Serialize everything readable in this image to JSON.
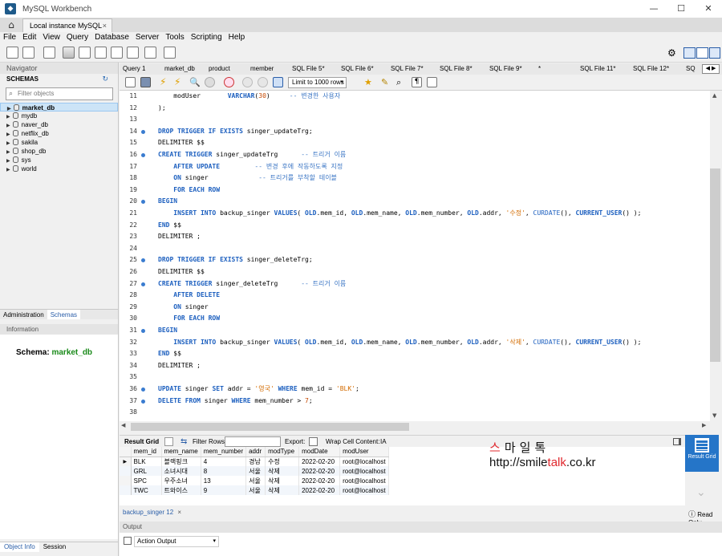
{
  "window": {
    "title": "MySQL Workbench",
    "tab_label": "Local instance MySQL"
  },
  "menu": [
    "File",
    "Edit",
    "View",
    "Query",
    "Database",
    "Server",
    "Tools",
    "Scripting",
    "Help"
  ],
  "navigator": {
    "header": "Navigator",
    "schemas_label": "SCHEMAS",
    "filter_placeholder": "Filter objects",
    "schemas": [
      "market_db",
      "mydb",
      "naver_db",
      "netflix_db",
      "sakila",
      "shop_db",
      "sys",
      "world"
    ],
    "selected": "market_db",
    "tabs": [
      "Administration",
      "Schemas"
    ],
    "info_header": "Information",
    "info_label": "Schema:",
    "info_value": "market_db",
    "bottom_tabs": [
      "Object Info",
      "Session"
    ]
  },
  "query_tabs": [
    "Query 1",
    "market_db",
    "product",
    "member",
    "SQL File 5*",
    "SQL File 6*",
    "SQL File 7*",
    "SQL File 8*",
    "SQL File 9*",
    "*",
    "SQL File 11*",
    "SQL File 12*",
    "SQ"
  ],
  "editor_toolbar": {
    "limit": "Limit to 1000 rows"
  },
  "code_lines": [
    {
      "n": "11",
      "dot": false,
      "html": "    modUser       <span class=\"kw\">VARCHAR</span>(<span class=\"nm\">30</span>)     <span class=\"cm\">-- 변경한 사용자</span>"
    },
    {
      "n": "12",
      "dot": false,
      "html": ");"
    },
    {
      "n": "13",
      "dot": false,
      "html": ""
    },
    {
      "n": "14",
      "dot": true,
      "html": "<span class=\"kw\">DROP TRIGGER IF EXISTS</span> singer_updateTrg;"
    },
    {
      "n": "15",
      "dot": false,
      "html": "DELIMITER $$"
    },
    {
      "n": "16",
      "dot": true,
      "html": "<span class=\"kw\">CREATE TRIGGER</span> singer_updateTrg      <span class=\"cm\">-- 트리거 이름</span>"
    },
    {
      "n": "17",
      "dot": false,
      "html": "    <span class=\"kw\">AFTER UPDATE</span>         <span class=\"cm\">-- 변경 후에 작동하도록 지정</span>"
    },
    {
      "n": "18",
      "dot": false,
      "html": "    <span class=\"kw\">ON</span> singer             <span class=\"cm\">-- 트리거를 부착할 테이블</span>"
    },
    {
      "n": "19",
      "dot": false,
      "html": "    <span class=\"kw\">FOR EACH ROW</span>"
    },
    {
      "n": "20",
      "dot": true,
      "html": "<span class=\"kw\">BEGIN</span>"
    },
    {
      "n": "21",
      "dot": false,
      "html": "    <span class=\"kw\">INSERT INTO</span> backup_singer <span class=\"kw\">VALUES</span>( <span class=\"kw\">OLD</span>.mem_id, <span class=\"kw\">OLD</span>.mem_name, <span class=\"kw\">OLD</span>.mem_number, <span class=\"kw\">OLD</span>.addr, <span class=\"st\">'수정'</span>, <span class=\"fn\">CURDATE</span>(), <span class=\"kw\">CURRENT_USER</span>() );"
    },
    {
      "n": "22",
      "dot": false,
      "html": "<span class=\"kw\">END</span> $$"
    },
    {
      "n": "23",
      "dot": false,
      "html": "DELIMITER ;"
    },
    {
      "n": "24",
      "dot": false,
      "html": ""
    },
    {
      "n": "25",
      "dot": true,
      "html": "<span class=\"kw\">DROP TRIGGER IF EXISTS</span> singer_deleteTrg;"
    },
    {
      "n": "26",
      "dot": false,
      "html": "DELIMITER $$"
    },
    {
      "n": "27",
      "dot": true,
      "html": "<span class=\"kw\">CREATE TRIGGER</span> singer_deleteTrg      <span class=\"cm\">-- 트리거 이름</span>"
    },
    {
      "n": "28",
      "dot": false,
      "html": "    <span class=\"kw\">AFTER DELETE</span>"
    },
    {
      "n": "29",
      "dot": false,
      "html": "    <span class=\"kw\">ON</span> singer"
    },
    {
      "n": "30",
      "dot": false,
      "html": "    <span class=\"kw\">FOR EACH ROW</span>"
    },
    {
      "n": "31",
      "dot": true,
      "html": "<span class=\"kw\">BEGIN</span>"
    },
    {
      "n": "32",
      "dot": false,
      "html": "    <span class=\"kw\">INSERT INTO</span> backup_singer <span class=\"kw\">VALUES</span>( <span class=\"kw\">OLD</span>.mem_id, <span class=\"kw\">OLD</span>.mem_name, <span class=\"kw\">OLD</span>.mem_number, <span class=\"kw\">OLD</span>.addr, <span class=\"st\">'삭제'</span>, <span class=\"fn\">CURDATE</span>(), <span class=\"kw\">CURRENT_USER</span>() );"
    },
    {
      "n": "33",
      "dot": false,
      "html": "<span class=\"kw\">END</span> $$"
    },
    {
      "n": "34",
      "dot": false,
      "html": "DELIMITER ;"
    },
    {
      "n": "35",
      "dot": false,
      "html": ""
    },
    {
      "n": "36",
      "dot": true,
      "html": "<span class=\"kw\">UPDATE</span> singer <span class=\"kw\">SET</span> addr = <span class=\"st\">'영국'</span> <span class=\"kw\">WHERE</span> mem_id = <span class=\"st\">'BLK'</span>;"
    },
    {
      "n": "37",
      "dot": true,
      "html": "<span class=\"kw\">DELETE FROM</span> singer <span class=\"kw\">WHERE</span> mem_number &gt; <span class=\"nm\">7</span>;"
    },
    {
      "n": "38",
      "dot": false,
      "html": ""
    }
  ],
  "result": {
    "grid_label": "Result Grid",
    "filter_label": "Filter Rows:",
    "export_label": "Export:",
    "wrap_label": "Wrap Cell Content:",
    "wrap_icon": "IA",
    "columns": [
      "mem_id",
      "mem_name",
      "mem_number",
      "addr",
      "modType",
      "modDate",
      "modUser"
    ],
    "rows": [
      [
        "BLK",
        "블랙핑크",
        "4",
        "경남",
        "수정",
        "2022-02-20",
        "root@localhost"
      ],
      [
        "GRL",
        "소녀시대",
        "8",
        "서울",
        "삭제",
        "2022-02-20",
        "root@localhost"
      ],
      [
        "SPC",
        "우주소녀",
        "13",
        "서울",
        "삭제",
        "2022-02-20",
        "root@localhost"
      ],
      [
        "TWC",
        "트와이스",
        "9",
        "서울",
        "삭제",
        "2022-02-20",
        "root@localhost"
      ]
    ],
    "side_button": "Result Grid",
    "tab_label": "backup_singer 12",
    "readonly": "Read Only"
  },
  "output": {
    "header": "Output",
    "action": "Action Output"
  },
  "watermark": {
    "korean_pre": "스",
    "korean_rest": "마일톡",
    "url_pre": "http://smile",
    "url_red": "talk",
    "url_post": ".co.kr"
  }
}
